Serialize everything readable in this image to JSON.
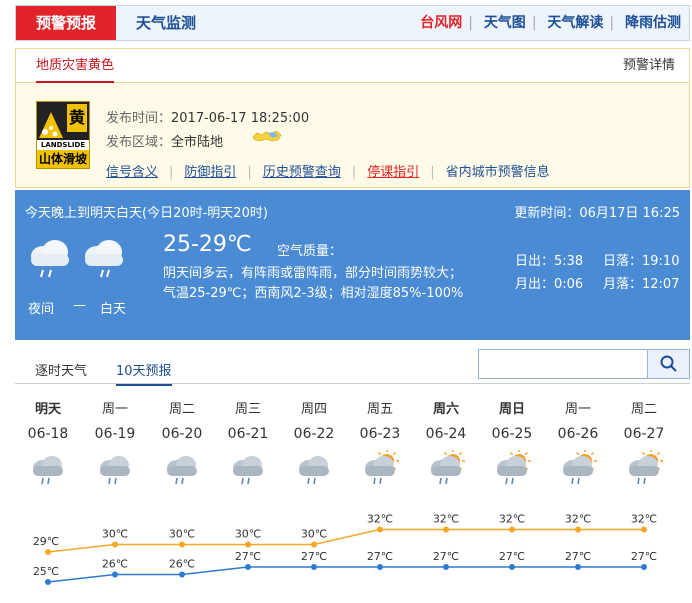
{
  "topbar": {
    "active_tab": "预警预报",
    "monitor_tab": "天气监测",
    "links": [
      "台风网",
      "天气图",
      "天气解读",
      "降雨估测"
    ]
  },
  "warning": {
    "title": "地质灾害黄色",
    "detail_link": "预警详情",
    "icon_text_top": "黄",
    "icon_text_mid": "LANDSLIDE",
    "icon_text_bottom": "山体滑坡",
    "publish_label": "发布时间：",
    "publish_time": "2017-06-17 18:25:00",
    "area_label": "发布区域：",
    "area": "全市陆地",
    "links": [
      "信号含义",
      "防御指引",
      "历史预警查询",
      "停课指引",
      "省内城市预警信息"
    ],
    "colors": {
      "badge": "#f2c200",
      "accent": "#c8161e"
    }
  },
  "forecast": {
    "range": "今天晚上到明天白天(今日20时-明天20时)",
    "update": "更新时间：06月17日 16:25",
    "temp": "25-29℃",
    "aq_label": "空气质量：",
    "desc_line1": "阴天间多云，有阵雨或雷阵雨，部分时间雨势较大；",
    "desc_line2": "气温25-29℃；西南风2-3级；相对湿度85%-100%",
    "night_label": "夜间",
    "dash": "—",
    "day_label": "白天",
    "sunrise": "日出：5:38",
    "sunset": "日落：19:10",
    "moonrise": "月出：0:06",
    "moonset": "月落：12:07"
  },
  "tabs": {
    "hourly": "逐时天气",
    "ten_day": "10天预报",
    "search_icon": "search-icon"
  },
  "days": [
    {
      "name": "明天",
      "date": "06-18",
      "icon": "rain",
      "bold": true
    },
    {
      "name": "周一",
      "date": "06-19",
      "icon": "rain",
      "bold": false
    },
    {
      "name": "周二",
      "date": "06-20",
      "icon": "rain",
      "bold": false
    },
    {
      "name": "周三",
      "date": "06-21",
      "icon": "rain",
      "bold": false
    },
    {
      "name": "周四",
      "date": "06-22",
      "icon": "rain",
      "bold": false
    },
    {
      "name": "周五",
      "date": "06-23",
      "icon": "sun-rain",
      "bold": false
    },
    {
      "name": "周六",
      "date": "06-24",
      "icon": "sun-rain",
      "bold": true
    },
    {
      "name": "周日",
      "date": "06-25",
      "icon": "sun-rain",
      "bold": true
    },
    {
      "name": "周一",
      "date": "06-26",
      "icon": "sun-rain",
      "bold": false
    },
    {
      "name": "周二",
      "date": "06-27",
      "icon": "sun-rain",
      "bold": false
    }
  ],
  "chart_data": {
    "type": "line",
    "categories": [
      "06-18",
      "06-19",
      "06-20",
      "06-21",
      "06-22",
      "06-23",
      "06-24",
      "06-25",
      "06-26",
      "06-27"
    ],
    "series": [
      {
        "values": [
          29,
          30,
          30,
          30,
          30,
          32,
          32,
          32,
          32,
          32
        ],
        "color": "#f5a623"
      },
      {
        "values": [
          25,
          26,
          26,
          27,
          27,
          27,
          27,
          27,
          27,
          27
        ],
        "color": "#2e7bcf"
      }
    ],
    "unit": "℃"
  }
}
